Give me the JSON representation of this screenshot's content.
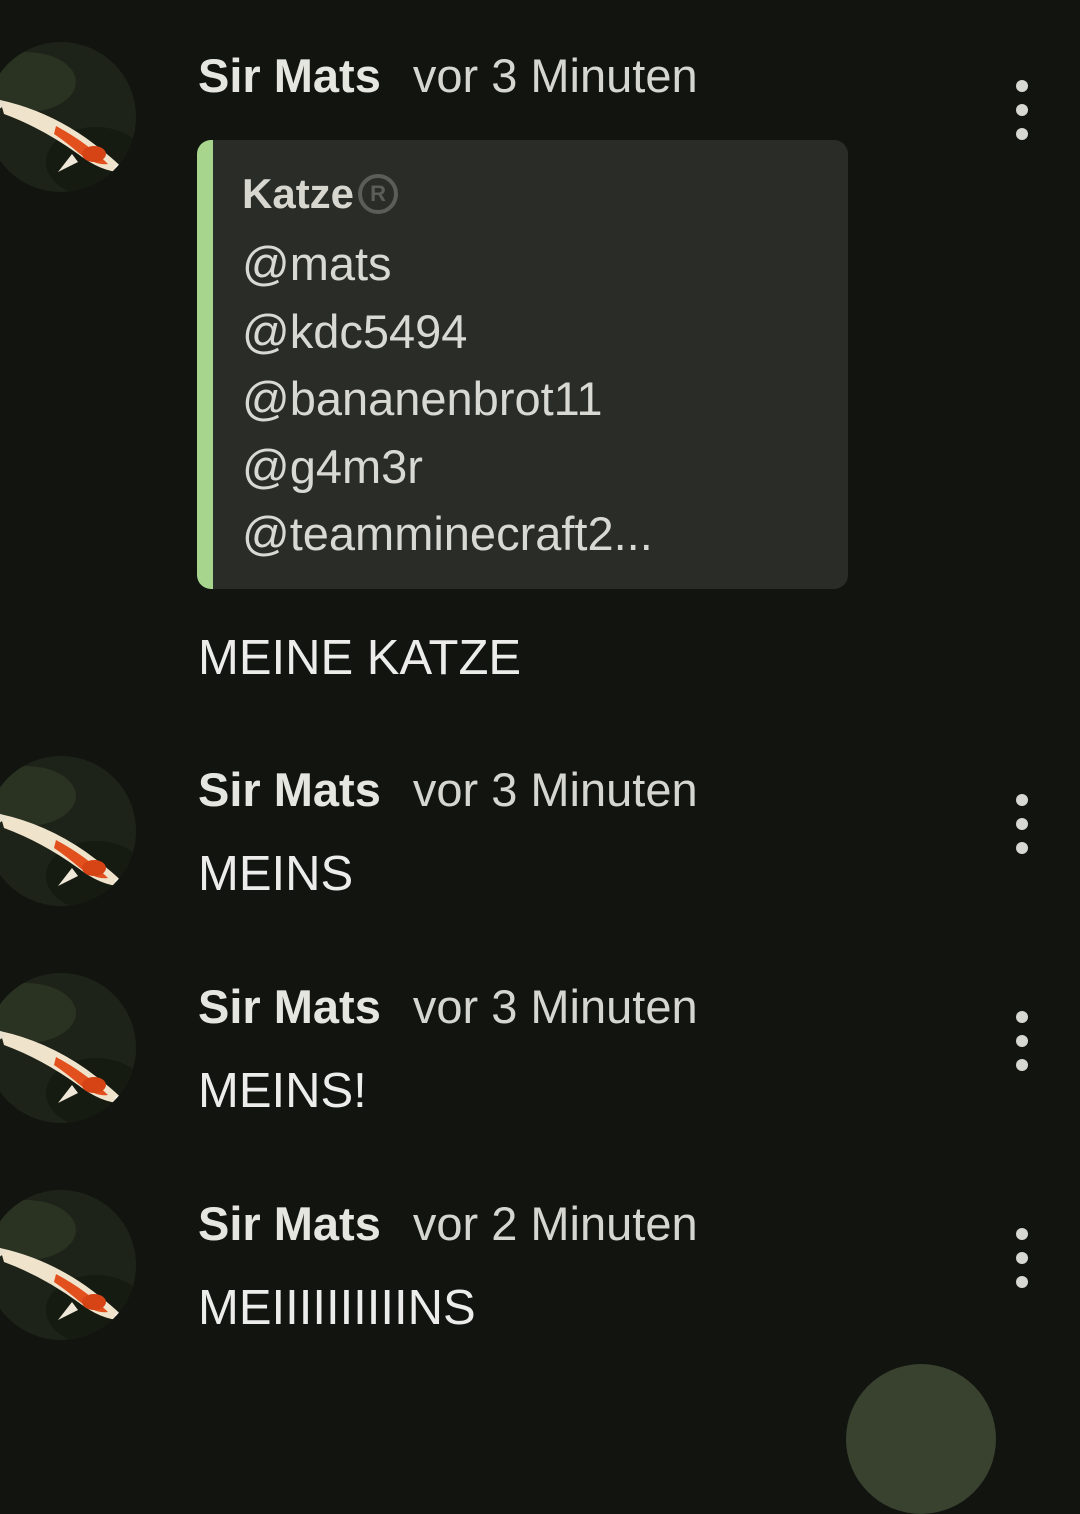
{
  "messages": [
    {
      "author": "Sir Mats",
      "time": "vor 3 Minuten",
      "quote": {
        "author": "Katze",
        "badge": "R",
        "lines": [
          "@mats",
          "@kdc5494",
          "@bananenbrot11",
          "@g4m3r",
          "@teamminecraft2..."
        ]
      },
      "text": "MEINE KATZE"
    },
    {
      "author": "Sir Mats",
      "time": "vor 3 Minuten",
      "text": "MEINS"
    },
    {
      "author": "Sir Mats",
      "time": "vor 3 Minuten",
      "text": "MEINS!"
    },
    {
      "author": "Sir Mats",
      "time": "vor 2 Minuten",
      "text": "MEIIIIIIIIIINS"
    }
  ],
  "icons": {
    "more_options": "more-vertical-icon",
    "badge": "registered-icon"
  },
  "colors": {
    "background": "#121410",
    "quote_background": "#2a2c28",
    "quote_accent": "#a7d58e"
  }
}
